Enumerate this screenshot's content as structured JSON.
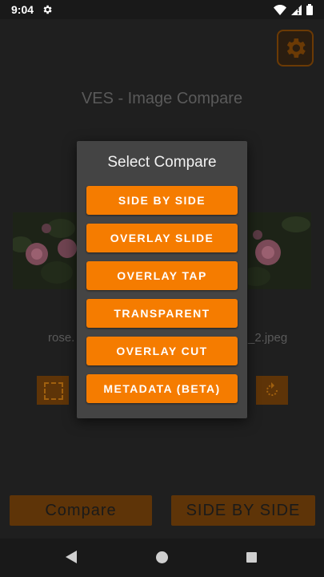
{
  "status_bar": {
    "time": "9:04"
  },
  "app": {
    "title": "VES - Image Compare"
  },
  "images": {
    "left_filename": "rose.",
    "right_filename": "_2.jpeg"
  },
  "bottom": {
    "compare_label": "Compare",
    "mode_label": "SIDE BY SIDE"
  },
  "dialog": {
    "title": "Select Compare",
    "options": [
      {
        "label": "SIDE BY SIDE"
      },
      {
        "label": "OVERLAY SLIDE"
      },
      {
        "label": "OVERLAY TAP"
      },
      {
        "label": "TRANSPARENT"
      },
      {
        "label": "OVERLAY CUT"
      },
      {
        "label": "METADATA (BETA)"
      }
    ]
  },
  "colors": {
    "accent": "#f57c00",
    "accent_dim": "#5e3408",
    "background": "#1f1f1f",
    "dialog": "#444444"
  },
  "icons": [
    "settings-gear-icon",
    "wifi-icon",
    "cell-signal-icon",
    "battery-icon",
    "crop-icon",
    "rotate-icon",
    "back-icon",
    "home-icon",
    "recents-icon"
  ]
}
